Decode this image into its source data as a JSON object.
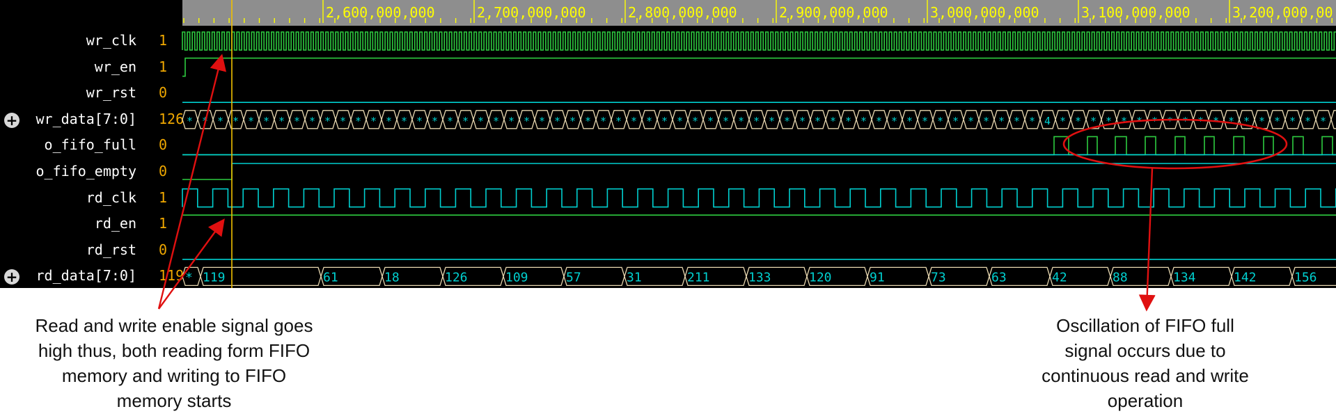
{
  "ruler": {
    "labels": [
      "2,600,000,000",
      "2,700,000,000",
      "2,800,000,000",
      "2,900,000,000",
      "3,000,000,000",
      "3,100,000,000",
      "3,200,000,00"
    ]
  },
  "signals": [
    {
      "name": "wr_clk",
      "value": "1",
      "expandable": false
    },
    {
      "name": "wr_en",
      "value": "1",
      "expandable": false
    },
    {
      "name": "wr_rst",
      "value": "0",
      "expandable": false
    },
    {
      "name": "wr_data[7:0]",
      "value": "126",
      "expandable": true
    },
    {
      "name": "o_fifo_full",
      "value": "0",
      "expandable": false
    },
    {
      "name": "o_fifo_empty",
      "value": "0",
      "expandable": false
    },
    {
      "name": "rd_clk",
      "value": "1",
      "expandable": false
    },
    {
      "name": "rd_en",
      "value": "1",
      "expandable": false
    },
    {
      "name": "rd_rst",
      "value": "0",
      "expandable": false
    },
    {
      "name": "rd_data[7:0]",
      "value": "119",
      "expandable": true
    }
  ],
  "wr_data_bus": {
    "label": "*",
    "mid_label": "4"
  },
  "rd_data_bus": {
    "first_label": "*",
    "values": [
      "119",
      "61",
      "18",
      "126",
      "109",
      "57",
      "31",
      "211",
      "133",
      "120",
      "91",
      "73",
      "63",
      "42",
      "88",
      "134",
      "142",
      "156"
    ]
  },
  "annotations": {
    "left": "Read and write enable signal goes high thus, both reading form FIFO memory and writing to FIFO memory starts",
    "right": "Oscillation of FIFO full signal occurs due to continuous read and write operation"
  },
  "colors": {
    "wave_green": "#2ecc40",
    "wave_cyan": "#00d0d0",
    "bus_outline": "#e8d8b0",
    "cursor": "#f0c000",
    "ruler_bg": "#8e8e8e",
    "ruler_text": "#ffff00",
    "value_text": "#f0a800",
    "annotation_red": "#e01010"
  }
}
